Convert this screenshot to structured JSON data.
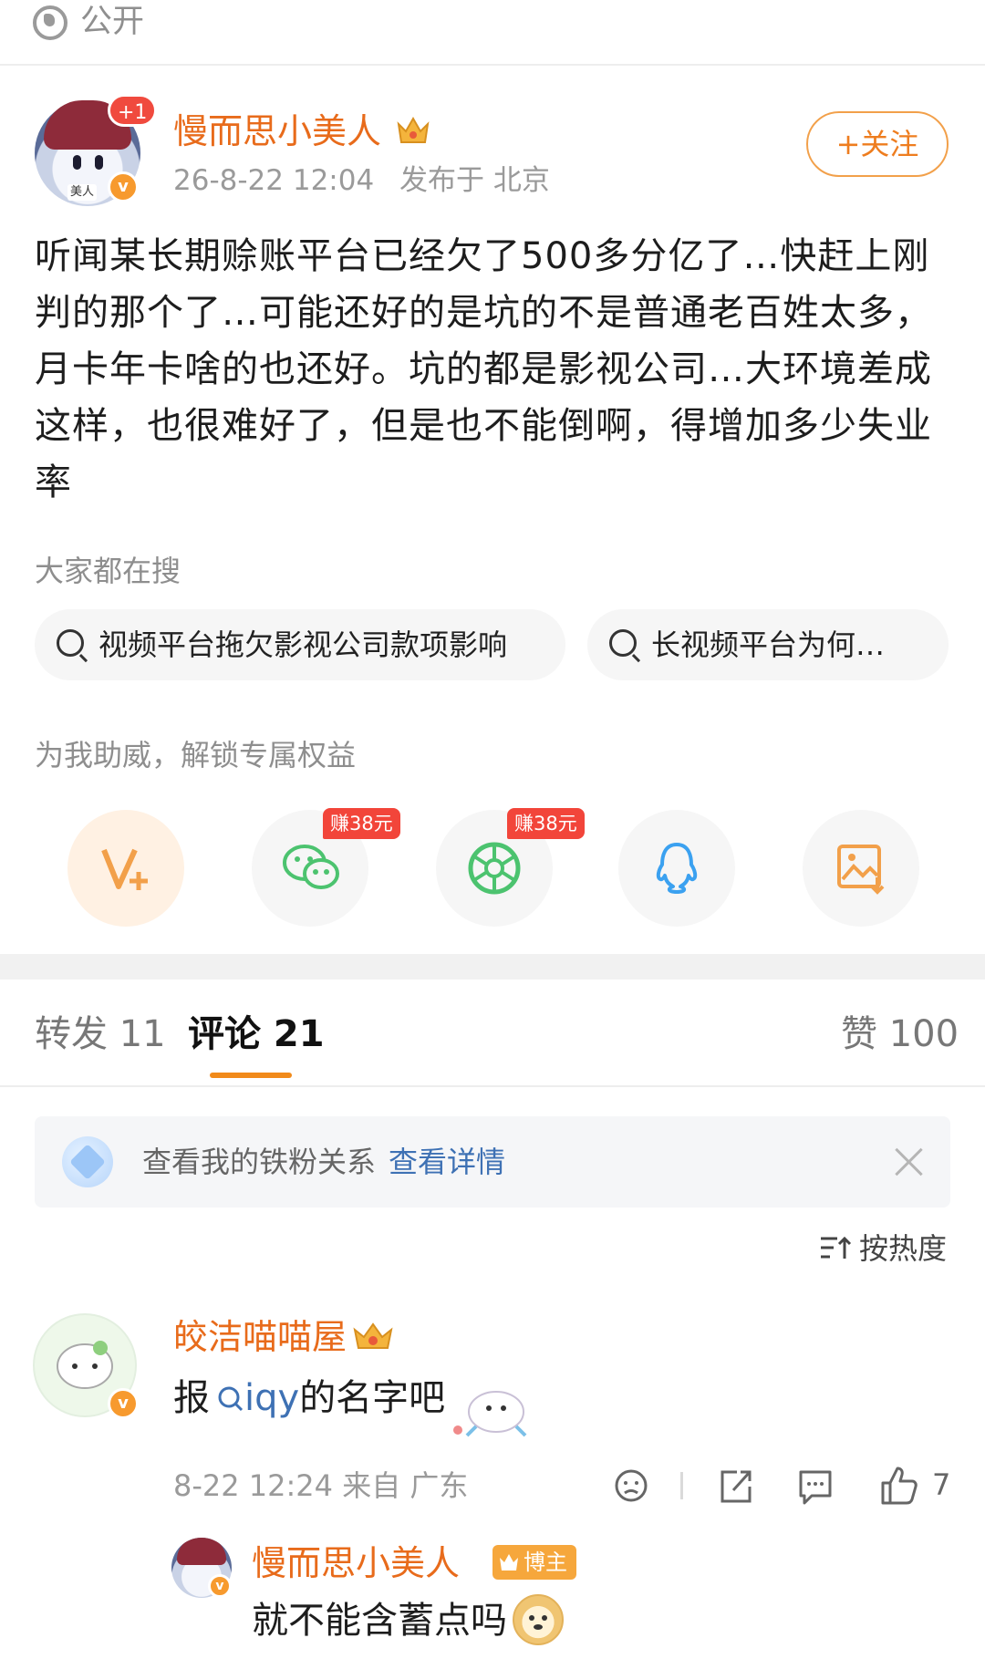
{
  "visibility": {
    "label": "公开"
  },
  "post": {
    "author": {
      "name": "慢而思小美人",
      "avatar_tag": "美人",
      "badge": "+1",
      "verified": "v"
    },
    "time": "26-8-22 12:04",
    "location": "发布于 北京",
    "follow_label": "+关注",
    "body": "听闻某长期赊账平台已经欠了500多分亿了…快赶上刚判的那个了…可能还好的是坑的不是普通老百姓太多，月卡年卡啥的也还好。坑的都是影视公司…大环境差成这样，也很难好了，但是也不能倒啊，得增加多少失业率"
  },
  "search": {
    "label": "大家都在搜",
    "chips": [
      "视频平台拖欠影视公司款项影响",
      "长视频平台为何…"
    ]
  },
  "support": {
    "label": "为我助威，解锁专属权益",
    "shares": [
      {
        "icon": "weibo-vplus-icon",
        "color": "#f2a04a"
      },
      {
        "icon": "wechat-icon",
        "color": "#4cc36f",
        "earn": "赚38元"
      },
      {
        "icon": "moments-icon",
        "color": "#4cc36f",
        "earn": "赚38元"
      },
      {
        "icon": "qq-icon",
        "color": "#3ba1f0"
      },
      {
        "icon": "save-image-icon",
        "color": "#f2a04a"
      }
    ]
  },
  "tabs": {
    "repost": "转发 11",
    "comments": "评论 21",
    "likes": "赞 100"
  },
  "fans_bar": {
    "text": "查看我的铁粉关系",
    "link": "查看详情"
  },
  "sort_label": "按热度",
  "comment": {
    "author": "皎洁喵喵屋",
    "text": "报",
    "search_term": "iqy",
    "text_after": "的名字吧",
    "meta": "8-22 12:24 来自 广东",
    "likes": "7"
  },
  "reply": {
    "author": "慢而思小美人",
    "host_tag": "博主",
    "text": "就不能含蓄点吗"
  },
  "colors": {
    "accent": "#e86b1b",
    "link": "#3e71b4",
    "earn_red": "#f2453a"
  }
}
